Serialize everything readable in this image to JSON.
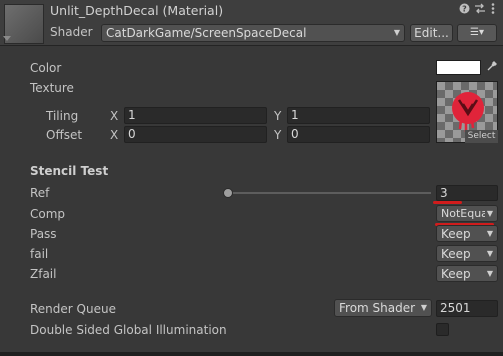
{
  "header": {
    "title": "Unlit_DepthDecal (Material)",
    "shader_label": "Shader",
    "shader_value": "CatDarkGame/ScreenSpaceDecal",
    "edit_button": "Edit...",
    "list_button": "☰▾"
  },
  "icons": {
    "help": "?",
    "presets": "⇆",
    "menu": "⋮"
  },
  "properties": {
    "color_label": "Color",
    "color_value": "#ffffff",
    "texture_label": "Texture",
    "tiling_label": "Tiling",
    "offset_label": "Offset",
    "x_axis": "X",
    "y_axis": "Y",
    "tiling_x": "1",
    "tiling_y": "1",
    "offset_x": "0",
    "offset_y": "0",
    "select_label": "Select"
  },
  "stencil": {
    "header": "Stencil Test",
    "ref_label": "Ref",
    "ref_value": "3",
    "comp_label": "Comp",
    "comp_value": "NotEqual",
    "pass_label": "Pass",
    "pass_value": "Keep",
    "fail_label": "fail",
    "fail_value": "Keep",
    "zfail_label": "Zfail",
    "zfail_value": "Keep"
  },
  "render": {
    "queue_label": "Render Queue",
    "queue_mode": "From Shader",
    "queue_value": "2501",
    "dsgi_label": "Double Sided Global Illumination"
  },
  "colors": {
    "annotation_red": "#d11c1c",
    "badge_red": "#e0243a"
  }
}
